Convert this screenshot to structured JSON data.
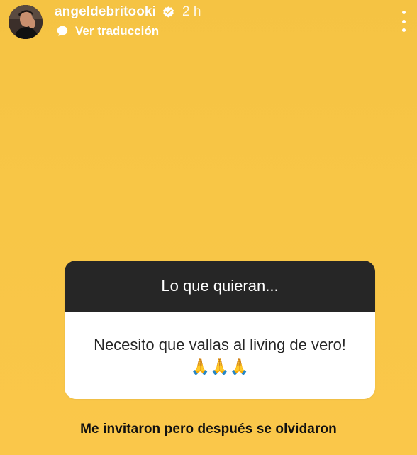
{
  "header": {
    "username": "angeldebritooki",
    "time": "2 h",
    "translate_label": "Ver traducción",
    "verified_color": "#FFFFFF"
  },
  "sticker": {
    "title": "Lo que quieran...",
    "answer": "Necesito que vallas al living de vero! 🙏🙏🙏"
  },
  "caption": "Me invitaron pero después se olvidaron",
  "colors": {
    "background": "#F8C646",
    "sticker_header": "#262626",
    "sticker_body": "#FFFFFF"
  },
  "icons": [
    "avatar",
    "verified-icon",
    "translate-icon",
    "more-options-icon"
  ]
}
